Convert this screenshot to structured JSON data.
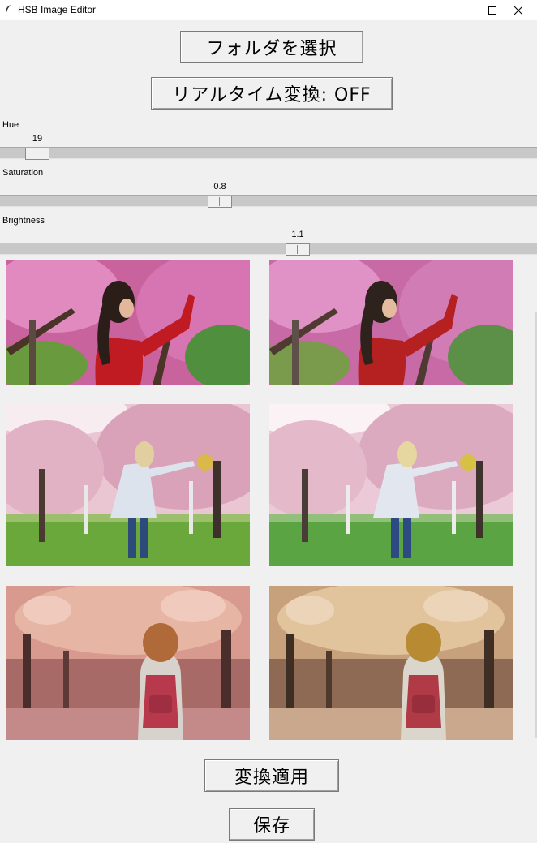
{
  "window": {
    "title": "HSB Image Editor",
    "controls": [
      "minimize",
      "maximize",
      "close"
    ]
  },
  "buttons": {
    "select_folder": "フォルダを選択",
    "realtime_toggle": "リアルタイム変換: OFF",
    "apply": "変換適用",
    "save": "保存"
  },
  "sliders": {
    "hue": {
      "label": "Hue",
      "value": "19",
      "fraction": 0.07
    },
    "saturation": {
      "label": "Saturation",
      "value": "0.8",
      "fraction": 0.41
    },
    "brightness": {
      "label": "Brightness",
      "value": "1.1",
      "fraction": 0.555
    }
  },
  "images": [
    {
      "original": "woman-red-jacket-cherry-blossoms",
      "converted": "woman-red-jacket-cherry-blossoms-adjusted"
    },
    {
      "original": "woman-white-coat-cherry-park",
      "converted": "woman-white-coat-cherry-park-adjusted"
    },
    {
      "original": "girl-backpack-cherry-avenue",
      "converted": "girl-backpack-cherry-avenue-adjusted"
    }
  ]
}
